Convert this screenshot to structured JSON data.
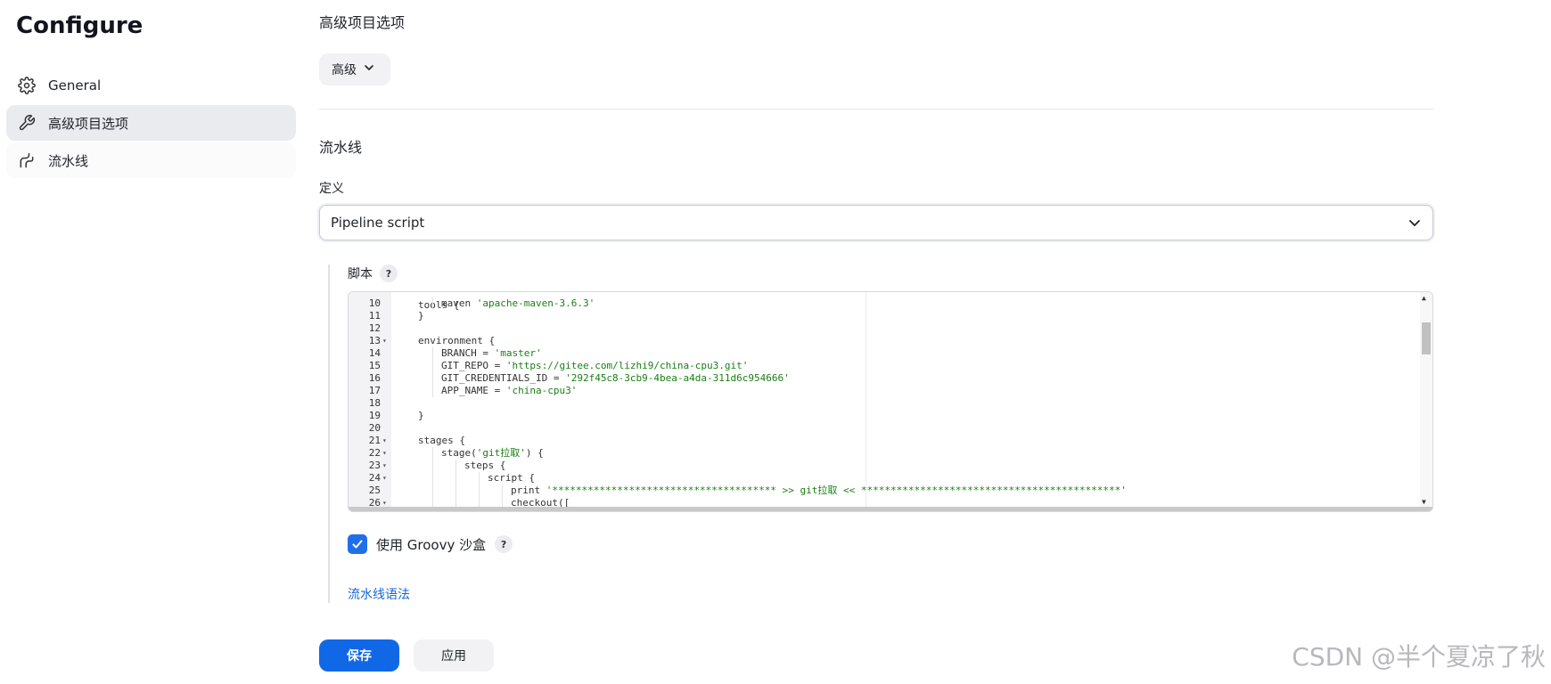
{
  "sidebar": {
    "title": "Configure",
    "items": [
      {
        "label": "General",
        "icon": "gear-icon"
      },
      {
        "label": "高级项目选项",
        "icon": "wrench-icon"
      },
      {
        "label": "流水线",
        "icon": "pipeline-icon"
      }
    ]
  },
  "advanced": {
    "title": "高级项目选项",
    "button_label": "高级"
  },
  "pipeline": {
    "title": "流水线",
    "definition_label": "定义",
    "definition_value": "Pipeline script",
    "script_label": "脚本",
    "help": "?",
    "sandbox_label": "使用 Groovy 沙盒",
    "syntax_link": "流水线语法"
  },
  "code_lines": [
    {
      "n": "10",
      "fold": "",
      "indent": 2,
      "text": "maven ",
      "str": "'apache-maven-3.6.3'"
    },
    {
      "n": "11",
      "fold": "",
      "indent": 1,
      "text": "}",
      "str": ""
    },
    {
      "n": "12",
      "fold": "",
      "indent": 0,
      "text": "",
      "str": ""
    },
    {
      "n": "13",
      "fold": "▾",
      "indent": 1,
      "text": "environment {",
      "str": ""
    },
    {
      "n": "14",
      "fold": "",
      "indent": 2,
      "text": "BRANCH = ",
      "str": "'master'"
    },
    {
      "n": "15",
      "fold": "",
      "indent": 2,
      "text": "GIT_REPO = ",
      "str": "'https://gitee.com/lizhi9/china-cpu3.git'"
    },
    {
      "n": "16",
      "fold": "",
      "indent": 2,
      "text": "GIT_CREDENTIALS_ID = ",
      "str": "'292f45c8-3cb9-4bea-a4da-311d6c954666'"
    },
    {
      "n": "17",
      "fold": "",
      "indent": 2,
      "text": "APP_NAME = ",
      "str": "'china-cpu3'"
    },
    {
      "n": "18",
      "fold": "",
      "indent": 0,
      "text": "",
      "str": ""
    },
    {
      "n": "19",
      "fold": "",
      "indent": 1,
      "text": "}",
      "str": ""
    },
    {
      "n": "20",
      "fold": "",
      "indent": 0,
      "text": "",
      "str": ""
    },
    {
      "n": "21",
      "fold": "▾",
      "indent": 1,
      "text": "stages {",
      "str": ""
    },
    {
      "n": "22",
      "fold": "▾",
      "indent": 2,
      "text": "stage(",
      "str": "'git拉取'",
      "tail": ") {"
    },
    {
      "n": "23",
      "fold": "▾",
      "indent": 3,
      "text": "steps {",
      "str": ""
    },
    {
      "n": "24",
      "fold": "▾",
      "indent": 4,
      "text": "script {",
      "str": ""
    },
    {
      "n": "25",
      "fold": "",
      "indent": 5,
      "text": "print ",
      "str": "'************************************** >> git拉取 << ********************************************'"
    },
    {
      "n": "26",
      "fold": "▾",
      "indent": 5,
      "text": "checkout([",
      "str": ""
    }
  ],
  "partial_top_text": "tools {",
  "actions": {
    "save": "保存",
    "apply": "应用"
  },
  "watermark": "CSDN @半个夏凉了秋",
  "colors": {
    "primary": "#1168e6",
    "checkbox": "#1f6feb",
    "link": "#1667d6",
    "string": "#1a7f15"
  }
}
